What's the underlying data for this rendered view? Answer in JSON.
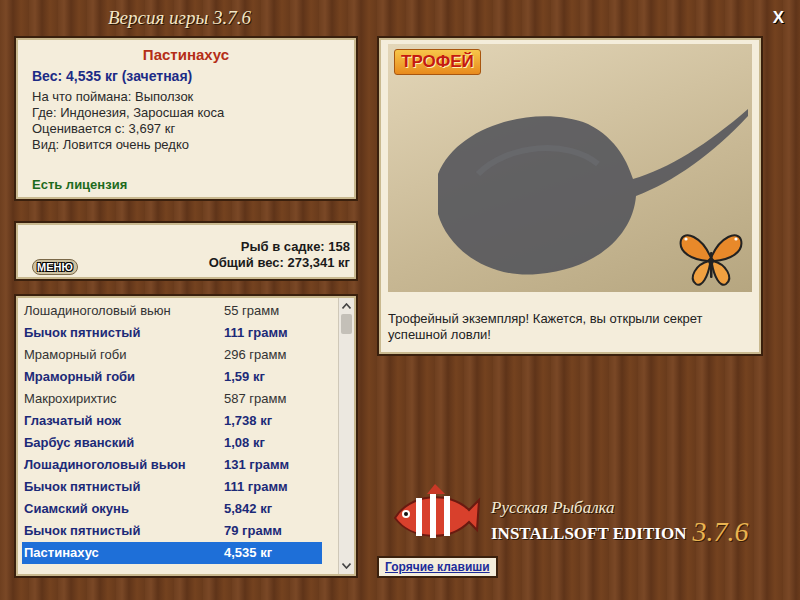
{
  "window": {
    "title": "Версия игры 3.7.6",
    "close": "X"
  },
  "fish": {
    "name": "Пастинахус",
    "weight": "Вес: 4,535 кг (зачетная)",
    "details": [
      "На что поймана: Выползок",
      "Где: Индонезия, Заросшая коса",
      "Оценивается с: 3,697 кг",
      "Вид: Ловится очень редко"
    ],
    "license": "Есть лицензия"
  },
  "summary": {
    "count": "Рыб в садке: 158",
    "total": "Общий вес: 273,341 кг"
  },
  "menu_button": "МЕНЮ",
  "catch_list": {
    "rows": [
      {
        "name": "Лошадиноголовый вьюн",
        "weight": "55 грамм",
        "counted": false,
        "selected": false
      },
      {
        "name": "Бычок пятнистый",
        "weight": "111 грамм",
        "counted": true,
        "selected": false
      },
      {
        "name": "Мраморный гоби",
        "weight": "296 грамм",
        "counted": false,
        "selected": false
      },
      {
        "name": "Мраморный гоби",
        "weight": "1,59 кг",
        "counted": true,
        "selected": false
      },
      {
        "name": "Макрохирихтис",
        "weight": "587 грамм",
        "counted": false,
        "selected": false
      },
      {
        "name": "Глазчатый нож",
        "weight": "1,738 кг",
        "counted": true,
        "selected": false
      },
      {
        "name": "Барбус яванский",
        "weight": "1,08 кг",
        "counted": true,
        "selected": false
      },
      {
        "name": "Лошадиноголовый вьюн",
        "weight": "131 грамм",
        "counted": true,
        "selected": false
      },
      {
        "name": "Бычок пятнистый",
        "weight": "111 грамм",
        "counted": true,
        "selected": false
      },
      {
        "name": "Сиамский окунь",
        "weight": "5,842 кг",
        "counted": true,
        "selected": false
      },
      {
        "name": "Бычок пятнистый",
        "weight": "79 грамм",
        "counted": true,
        "selected": false
      },
      {
        "name": "Пастинахус",
        "weight": "4,535 кг",
        "counted": true,
        "selected": true
      }
    ],
    "scrollbar": {
      "level": 0.95
    }
  },
  "photo": {
    "badge": "ТРОФЕЙ"
  },
  "message": "Трофейный экземпляр! Кажется, вы открыли секрет успешной ловли!",
  "logo": {
    "title": "Русская Рыбалка",
    "edition": "INSTALLSOFT EDITION",
    "version": "3.7.6"
  },
  "hotkeys_button": "Горячие клавиши"
}
